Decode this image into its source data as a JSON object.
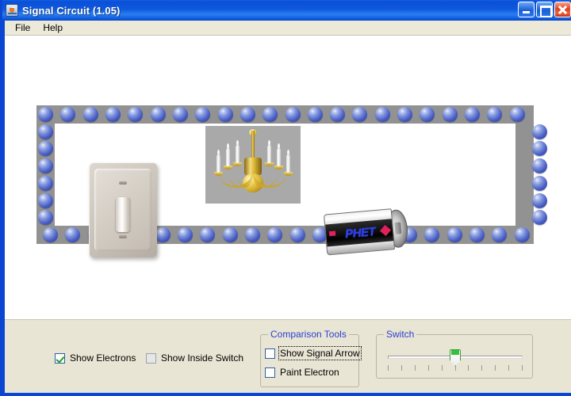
{
  "window": {
    "title": "Signal Circuit (1.05)",
    "icon": "java-coffee-cup-icon",
    "buttons": {
      "minimize": "Minimize",
      "maximize": "Maximize",
      "close": "Close"
    }
  },
  "menubar": {
    "items": [
      {
        "label": "File"
      },
      {
        "label": "Help"
      }
    ]
  },
  "canvas": {
    "circuit": {
      "switch_label": "light-switch",
      "bulb_label": "chandelier-lamp",
      "battery_label": "PHET",
      "electron_count_top": 22,
      "electron_count_bottom": 22,
      "electron_count_left": 6,
      "electron_count_right": 6
    }
  },
  "controls": {
    "show_electrons": {
      "label": "Show Electrons",
      "checked": true
    },
    "show_inside_switch": {
      "label": "Show Inside Switch",
      "checked": false,
      "disabled": true
    },
    "comparison_tools": {
      "title": "Comparison Tools",
      "items": [
        {
          "label": "Show Signal Arrow",
          "checked": false,
          "focused": true
        },
        {
          "label": "Paint Electron",
          "checked": false,
          "focused": false
        }
      ]
    },
    "switch_slider": {
      "title": "Switch",
      "value": 50,
      "min": 0,
      "max": 100,
      "tick_count": 11
    }
  },
  "colors": {
    "titlebar": "#0e59dd",
    "panel_bg": "#e9e5d4",
    "wire": "#929292",
    "electron": "#4a5fc4",
    "group_title": "#2a3fd0",
    "check_mark": "#1f9c2e",
    "slider_accent": "#35c03e",
    "battery_text": "#2b3df5"
  }
}
